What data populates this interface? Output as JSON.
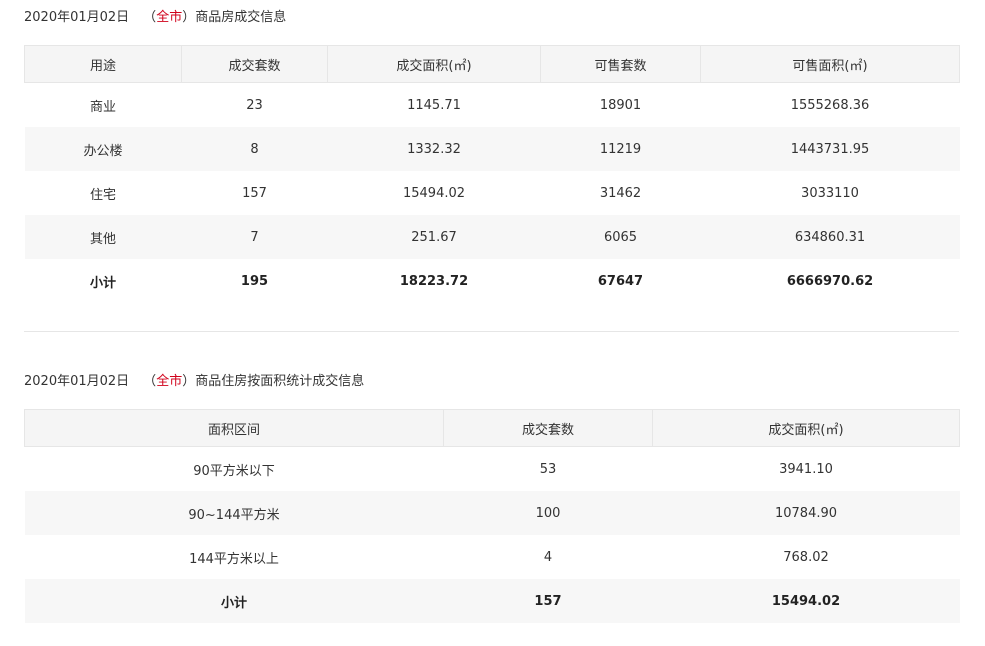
{
  "section1": {
    "date": "2020年01月02日",
    "paren_open": "（",
    "city": "全市",
    "paren_close": "）",
    "title": "商品房成交信息",
    "headers": [
      "用途",
      "成交套数",
      "成交面积(㎡)",
      "可售套数",
      "可售面积(㎡)"
    ],
    "rows": [
      [
        "商业",
        "23",
        "1145.71",
        "18901",
        "1555268.36"
      ],
      [
        "办公楼",
        "8",
        "1332.32",
        "11219",
        "1443731.95"
      ],
      [
        "住宅",
        "157",
        "15494.02",
        "31462",
        "3033110"
      ],
      [
        "其他",
        "7",
        "251.67",
        "6065",
        "634860.31"
      ]
    ],
    "total": [
      "小计",
      "195",
      "18223.72",
      "67647",
      "6666970.62"
    ]
  },
  "section2": {
    "date": "2020年01月02日",
    "paren_open": "（",
    "city": "全市",
    "paren_close": "）",
    "title": "商品住房按面积统计成交信息",
    "headers": [
      "面积区间",
      "成交套数",
      "成交面积(㎡)"
    ],
    "rows": [
      [
        "90平方米以下",
        "53",
        "3941.10"
      ],
      [
        "90~144平方米",
        "100",
        "10784.90"
      ],
      [
        "144平方米以上",
        "4",
        "768.02"
      ]
    ],
    "total": [
      "小计",
      "157",
      "15494.02"
    ]
  },
  "colors": {
    "accent_red": "#d0021b",
    "header_bg": "#f5f5f5",
    "stripe_bg": "#f7f7f7"
  }
}
